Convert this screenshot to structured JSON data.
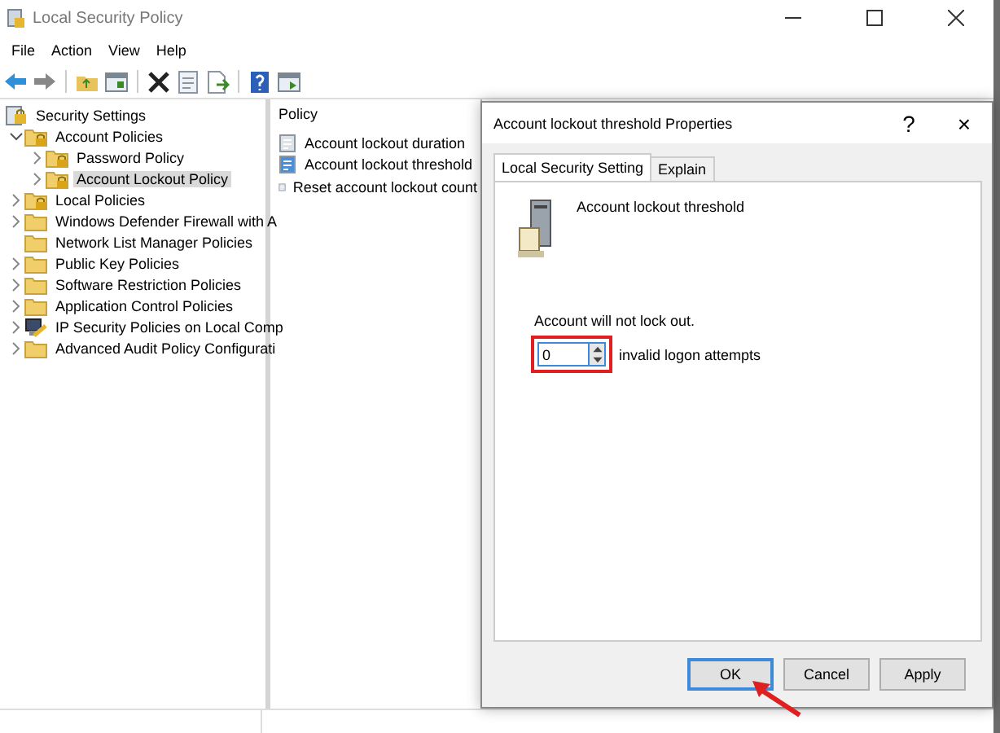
{
  "window": {
    "title": "Local Security Policy"
  },
  "menu": [
    "File",
    "Action",
    "View",
    "Help"
  ],
  "tree": [
    {
      "label": "Security Settings",
      "kind": "root",
      "selected": false,
      "children": [
        {
          "label": "Account Policies",
          "kind": "locked-folder",
          "expanded": true,
          "selected": false,
          "children": [
            {
              "label": "Password Policy",
              "kind": "locked-folder",
              "expanded": false,
              "selected": false
            },
            {
              "label": "Account Lockout Policy",
              "kind": "locked-folder",
              "expanded": false,
              "selected": true
            }
          ]
        },
        {
          "label": "Local Policies",
          "kind": "locked-folder",
          "expanded": false,
          "selected": false
        },
        {
          "label": "Windows Defender Firewall with A",
          "kind": "folder",
          "expanded": false,
          "selected": false
        },
        {
          "label": "Network List Manager Policies",
          "kind": "folder",
          "selected": false
        },
        {
          "label": "Public Key Policies",
          "kind": "folder",
          "expanded": false,
          "selected": false
        },
        {
          "label": "Software Restriction Policies",
          "kind": "folder",
          "expanded": false,
          "selected": false
        },
        {
          "label": "Application Control Policies",
          "kind": "folder",
          "expanded": false,
          "selected": false
        },
        {
          "label": "IP Security Policies on Local Comp",
          "kind": "computer",
          "expanded": false,
          "selected": false
        },
        {
          "label": "Advanced Audit Policy Configurati",
          "kind": "folder",
          "expanded": false,
          "selected": false
        }
      ]
    }
  ],
  "list": {
    "header": "Policy",
    "items": [
      {
        "label": "Account lockout duration",
        "selected": false
      },
      {
        "label": "Account lockout threshold",
        "selected": true
      },
      {
        "label": "Reset account lockout count",
        "selected": false
      }
    ]
  },
  "dialog": {
    "title": "Account lockout threshold Properties",
    "help": "?",
    "close": "×",
    "tabs": [
      {
        "label": "Local Security Setting",
        "selected": true
      },
      {
        "label": "Explain",
        "selected": false
      }
    ],
    "setting_name": "Account lockout threshold",
    "status": "Account will not lock out.",
    "spinner": {
      "value": "0",
      "suffix": "invalid logon attempts",
      "highlighted": true
    },
    "buttons": [
      {
        "label": "OK",
        "default": true
      },
      {
        "label": "Cancel",
        "default": false
      },
      {
        "label": "Apply",
        "default": false
      }
    ]
  }
}
